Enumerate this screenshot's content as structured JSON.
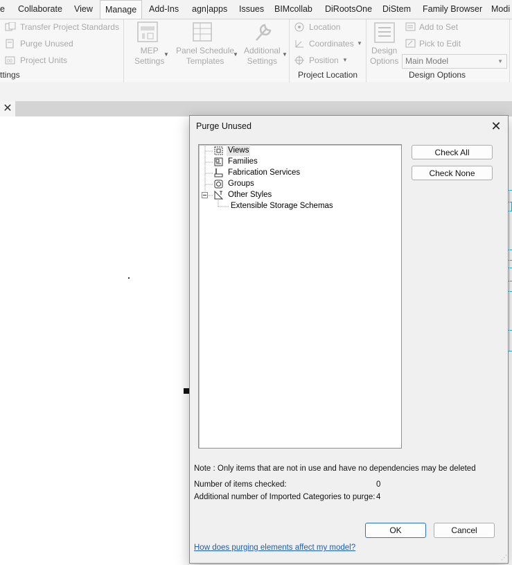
{
  "ribbon_tabs": [
    "e",
    "Collaborate",
    "View",
    "Manage",
    "Add-Ins",
    "agn|apps",
    "Issues",
    "BIMcollab",
    "DiRootsOne",
    "DiStem",
    "Family Browser",
    "Modi"
  ],
  "active_tab": "Manage",
  "ribbon": {
    "transfer_label": "Transfer  Project Standards",
    "purge_label": "Purge  Unused",
    "project_units_label": "Project  Units",
    "settings_panel": "ttings",
    "mep_settings": "MEP\nSettings",
    "panel_schedule": "Panel Schedule\nTemplates",
    "additional_settings": "Additional\nSettings",
    "location": "Location",
    "coordinates": "Coordinates",
    "position": "Position",
    "project_location_panel": "Project Location",
    "design_options_btn": "Design\nOptions",
    "add_to_set": "Add to Set",
    "pick_to_edit": "Pick to Edit",
    "main_model": "Main Model",
    "design_options_panel": "Design Options"
  },
  "dialog": {
    "title": "Purge Unused",
    "tree": [
      {
        "label": "Views",
        "icon": "views-icon"
      },
      {
        "label": "Families",
        "icon": "families-icon"
      },
      {
        "label": "Fabrication Services",
        "icon": "fabrication-icon"
      },
      {
        "label": "Groups",
        "icon": "groups-icon"
      },
      {
        "label": "Other Styles",
        "icon": "styles-icon",
        "expanded": true,
        "children": [
          "Extensible Storage Schemas"
        ]
      }
    ],
    "check_all": "Check All",
    "check_none": "Check None",
    "note": "Note : Only items that are not in use and have no dependencies may be deleted",
    "items_checked_label": "Number of items checked:",
    "items_checked_value": "0",
    "imported_label": "Additional number of Imported Categories to purge:",
    "imported_value": "4",
    "ok": "OK",
    "cancel": "Cancel",
    "help_link": "How does purging elements affect my model?"
  },
  "colors": {
    "accent": "#2b73c8",
    "link": "#1a5fb4",
    "model_lines": "#22b8c9"
  }
}
